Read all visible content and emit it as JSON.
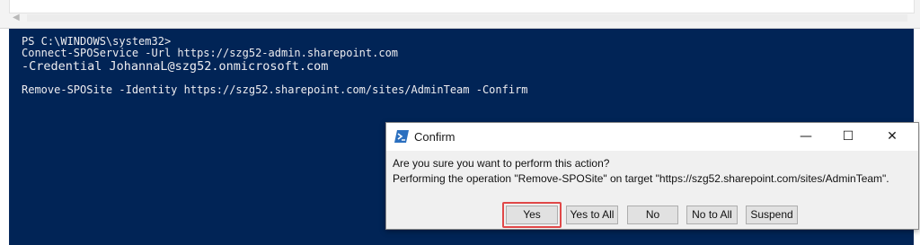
{
  "console": {
    "lines": [
      "PS C:\\WINDOWS\\system32>",
      "Connect-SPOService -Url https://szg52-admin.sharepoint.com",
      "-Credential JohannaL@szg52.onmicrosoft.com",
      "Remove-SPOSite -Identity https://szg52.sharepoint.com/sites/AdminTeam -Confirm"
    ],
    "background": "#012456",
    "foreground": "#eeedf0"
  },
  "dialog": {
    "title": "Confirm",
    "icon": "powershell-icon",
    "question": "Are you sure you want to perform this action?",
    "detail": "Performing the operation \"Remove-SPOSite\" on target \"https://szg52.sharepoint.com/sites/AdminTeam\".",
    "controls": {
      "minimize": "—",
      "maximize": "☐",
      "close": "✕"
    },
    "buttons": {
      "yes": "Yes",
      "yes_to_all": "Yes to All",
      "no": "No",
      "no_to_all": "No to All",
      "suspend": "Suspend"
    },
    "highlight_color": "#e04848"
  }
}
